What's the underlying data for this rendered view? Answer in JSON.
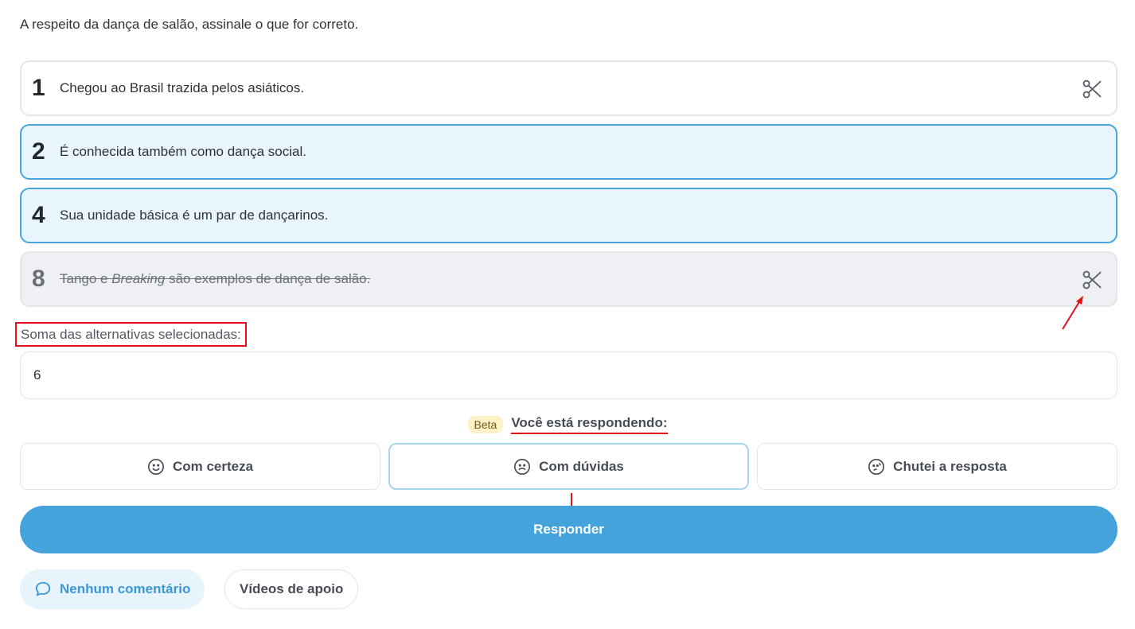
{
  "question": "A respeito da dança de salão, assinale o que for correto.",
  "alternatives": [
    {
      "number": "1",
      "text": "Chegou ao Brasil trazida pelos asiáticos.",
      "state": "default"
    },
    {
      "number": "2",
      "text": "É conhecida também como dança social.",
      "state": "selected"
    },
    {
      "number": "4",
      "text": "Sua unidade básica é um par de dançarinos.",
      "state": "selected"
    },
    {
      "number": "8",
      "text_before": "Tango e ",
      "text_italic": "Breaking",
      "text_after": " são exemplos de dança de salão.",
      "state": "eliminated"
    }
  ],
  "sum": {
    "label": "Soma das alternativas selecionadas:",
    "value": "6"
  },
  "confidence": {
    "beta_label": "Beta",
    "prompt": "Você está respondendo:",
    "options": [
      {
        "label": "Com certeza",
        "icon": "smile-icon"
      },
      {
        "label": "Com dúvidas",
        "icon": "neutral-face-icon",
        "active": true
      },
      {
        "label": "Chutei a resposta",
        "icon": "worried-face-icon"
      }
    ]
  },
  "submit_label": "Responder",
  "footer": {
    "comments_label": "Nenhum comentário",
    "videos_label": "Vídeos de apoio"
  },
  "colors": {
    "accent": "#45a3dc",
    "selected_bg": "#e8f5fd",
    "annotation": "#e1141b"
  }
}
